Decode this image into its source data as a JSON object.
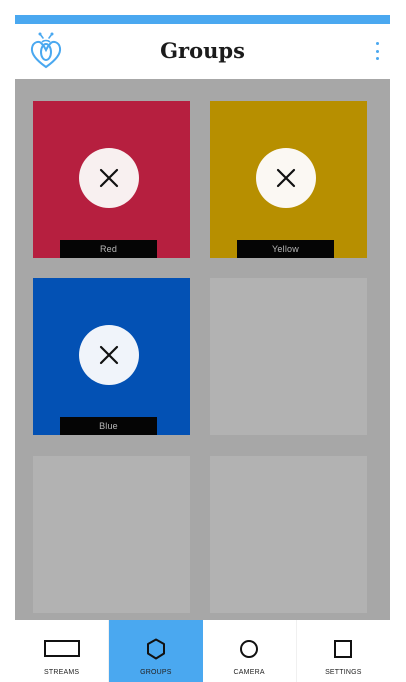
{
  "app": {
    "title": "Groups"
  },
  "colors": {
    "accent": "#4aa8f0",
    "red": "#b61f3f",
    "yellow": "#b78f00",
    "blue": "#0351b4",
    "empty_tile": "#b2b2b2",
    "grid_bg": "#a7a7a7"
  },
  "icons": {
    "logo": "bee-heart-logo",
    "menu": "more-vertical-icon",
    "remove": "close-icon"
  },
  "groups": [
    {
      "name": "Red",
      "color": "#b61f3f",
      "remove_bg": "#f8f0f0"
    },
    {
      "name": "Yellow",
      "color": "#b78f00",
      "remove_bg": "#fbf8f3"
    },
    {
      "name": "Blue",
      "color": "#0351b4",
      "remove_bg": "#f0f4fa"
    }
  ],
  "tabs": [
    {
      "label": "STREAMS",
      "icon": "rectangle-icon",
      "active": false
    },
    {
      "label": "GROUPS",
      "icon": "hexagon-icon",
      "active": true
    },
    {
      "label": "CAMERA",
      "icon": "circle-icon",
      "active": false
    },
    {
      "label": "SETTINGS",
      "icon": "square-icon",
      "active": false
    }
  ]
}
